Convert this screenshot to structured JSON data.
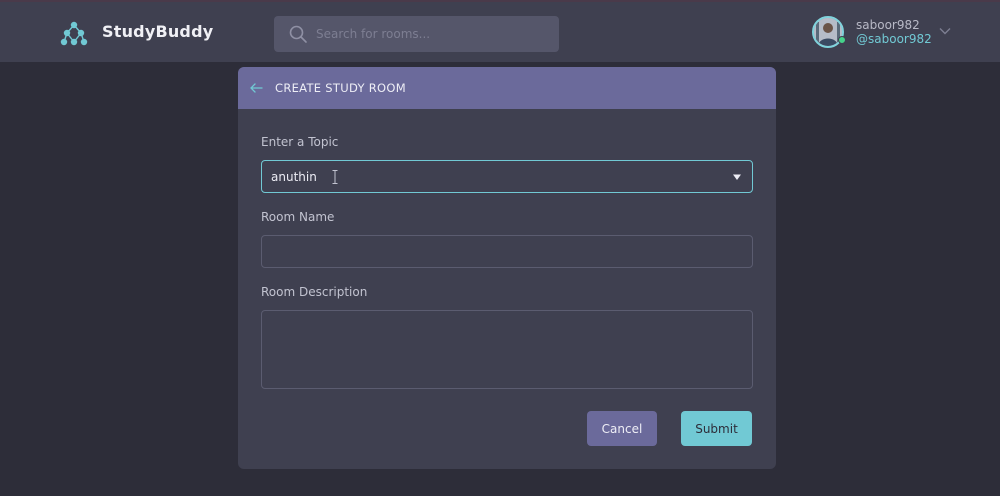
{
  "header": {
    "brand": "StudyBuddy",
    "search_placeholder": "Search for rooms...",
    "user": {
      "name": "saboor982",
      "handle": "@saboor982"
    }
  },
  "modal": {
    "title": "CREATE STUDY ROOM",
    "topic_label": "Enter a Topic",
    "topic_value": "anuthin",
    "room_name_label": "Room Name",
    "room_name_value": "",
    "description_label": "Room Description",
    "description_value": "",
    "cancel_label": "Cancel",
    "submit_label": "Submit"
  },
  "colors": {
    "accent": "#71c9d4",
    "primary": "#6b6a9b",
    "surface": "#3f4050",
    "background": "#2d2d39",
    "online": "#45d28a"
  },
  "icons": {
    "logo": "studybuddy-logo-icon",
    "search": "search-icon",
    "chevron": "chevron-down-icon",
    "back": "arrow-left-icon",
    "caret": "caret-down-icon",
    "cursor": "text-cursor-icon"
  }
}
